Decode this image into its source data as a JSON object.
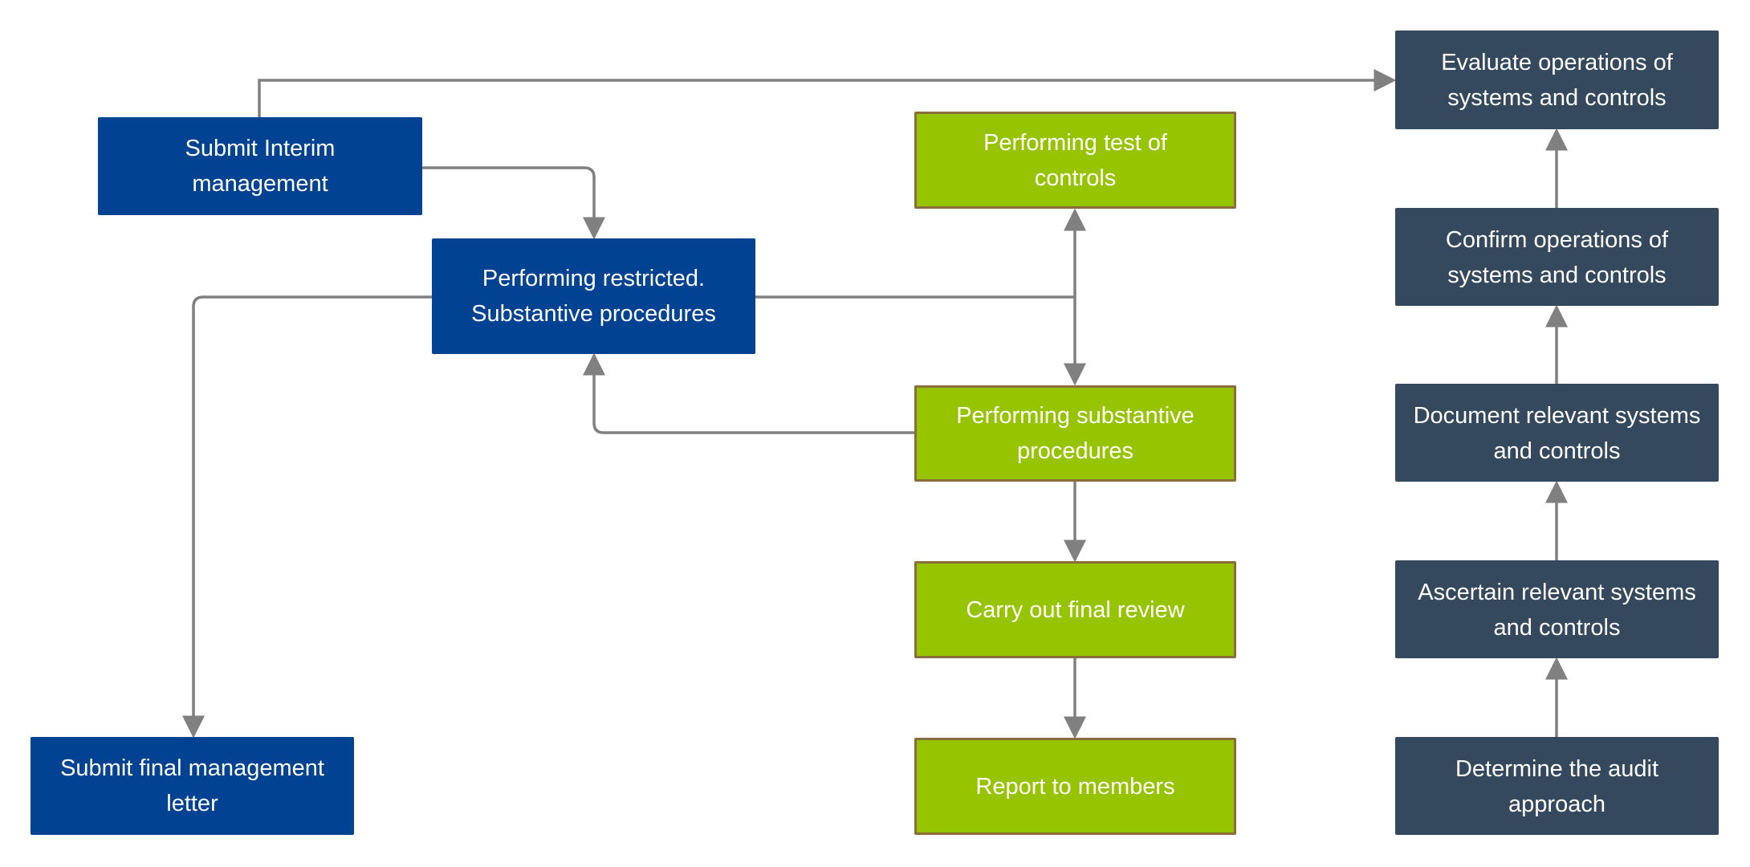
{
  "colors": {
    "blue": "#014293",
    "green": "#97c400",
    "green_border": "#8a6d3b",
    "dark": "#34495e",
    "connector": "#808080"
  },
  "nodes": {
    "submit_interim": "Submit Interim management",
    "restricted": "Performing restricted. Substantive procedures",
    "submit_final": "Submit final management letter",
    "test_controls": "Performing test of controls",
    "substantive": "Performing substantive procedures",
    "final_review": "Carry out final review",
    "report": "Report to members",
    "evaluate": "Evaluate operations of systems and controls",
    "confirm": "Confirm operations of systems and controls",
    "document": "Document relevant systems and controls",
    "ascertain": "Ascertain relevant systems and controls",
    "determine": "Determine the audit approach"
  }
}
